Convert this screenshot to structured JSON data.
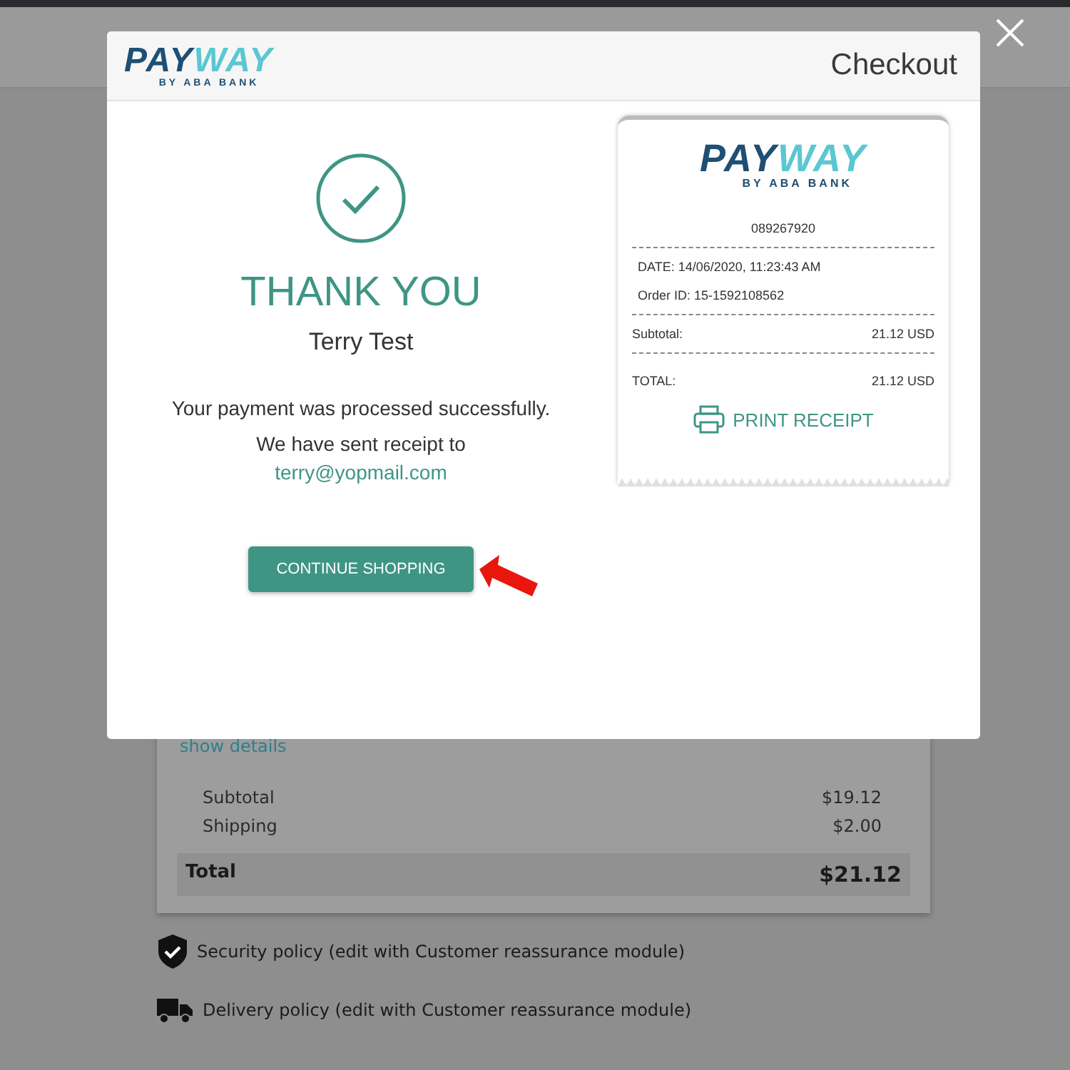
{
  "background": {
    "show_details": "show details",
    "summary": [
      {
        "label": "Subtotal",
        "value": "$19.12"
      },
      {
        "label": "Shipping",
        "value": "$2.00"
      }
    ],
    "total": {
      "label": "Total",
      "value": "$21.12"
    },
    "policies": [
      {
        "kind": "security",
        "text": "Security policy (edit with Customer reassurance module)"
      },
      {
        "kind": "delivery",
        "text": "Delivery policy (edit with Customer reassurance module)"
      }
    ]
  },
  "modal": {
    "logo": {
      "primary": "PAY",
      "accent": "WAY",
      "tagline": "BY ABA BANK"
    },
    "title": "Checkout",
    "heading": "THANK YOU",
    "name": "Terry Test",
    "message": "Your payment was processed successfully.",
    "receipt_note": "We have sent receipt to",
    "email": "terry@yopmail.com",
    "button": "CONTINUE SHOPPING",
    "receipt": {
      "logo": {
        "primary": "PAY",
        "accent": "WAY",
        "tagline": "BY ABA BANK"
      },
      "number": "089267920",
      "date": "DATE: 14/06/2020, 11:23:43 AM",
      "order": "Order ID: 15-1592108562",
      "subtotal": {
        "label": "Subtotal:",
        "value": "21.12 USD"
      },
      "total": {
        "label": "TOTAL:",
        "value": "21.12 USD"
      },
      "print": "PRINT RECEIPT"
    }
  }
}
